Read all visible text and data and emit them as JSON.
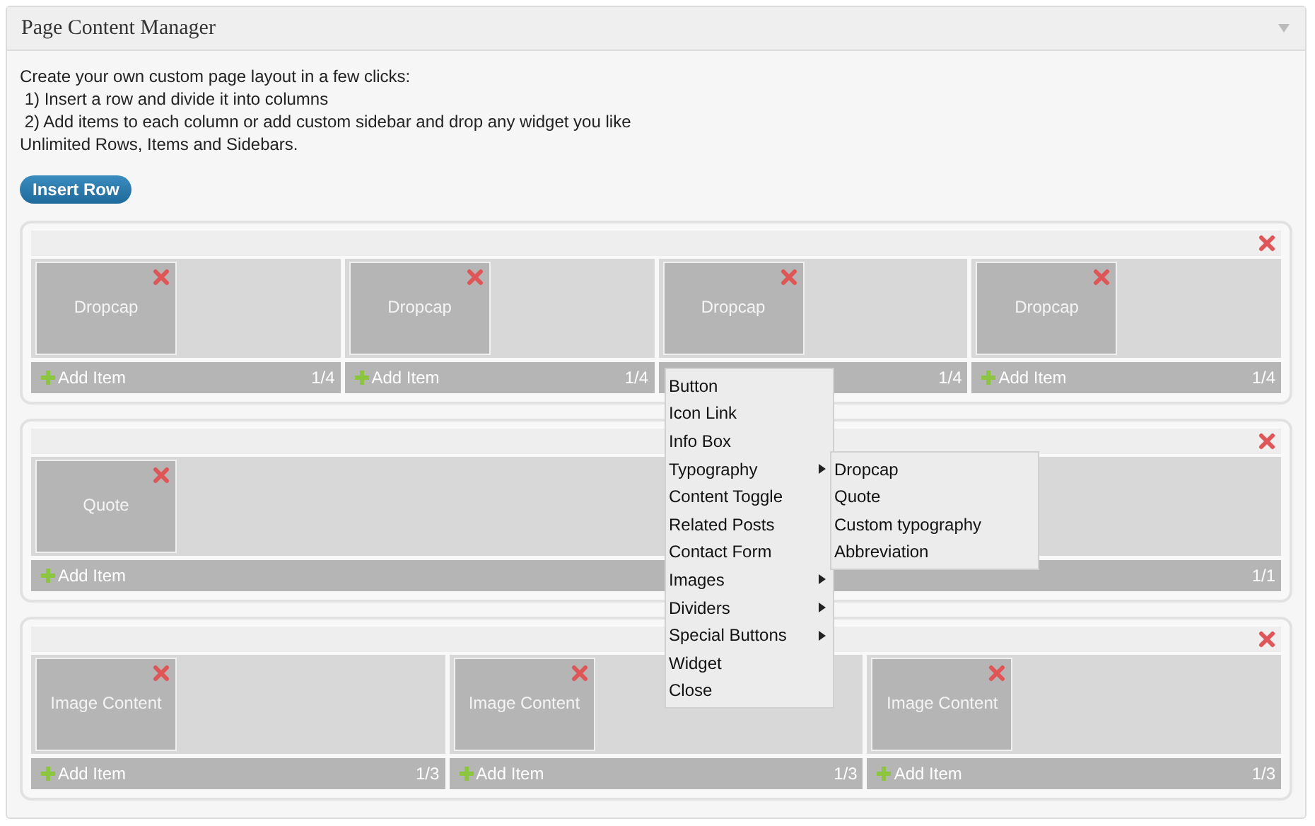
{
  "panel": {
    "title": "Page Content Manager"
  },
  "description": [
    "Create your own custom page layout in a few clicks:",
    " 1) Insert a row and divide it into columns",
    " 2) Add items to each column or add custom sidebar and drop any widget you like",
    "Unlimited Rows, Items and Sidebars."
  ],
  "insert_button": "Insert Row",
  "rows": [
    {
      "columns": [
        {
          "items": [
            "Dropcap"
          ],
          "add_item": "Add Item",
          "size": "1/4"
        },
        {
          "items": [
            "Dropcap"
          ],
          "add_item": "Add Item",
          "size": "1/4"
        },
        {
          "items": [
            "Dropcap"
          ],
          "size": "1/4"
        },
        {
          "items": [
            "Dropcap"
          ],
          "add_item": "Add Item",
          "size": "1/4"
        }
      ]
    },
    {
      "columns": [
        {
          "items": [
            "Quote"
          ],
          "add_item": "Add Item",
          "size": "1/1"
        }
      ]
    },
    {
      "columns": [
        {
          "items": [
            "Image Content"
          ],
          "add_item": "Add Item",
          "size": "1/3"
        },
        {
          "items": [
            "Image Content"
          ],
          "add_item": "Add Item",
          "size": "1/3"
        },
        {
          "items": [
            "Image Content"
          ],
          "add_item": "Add Item",
          "size": "1/3"
        }
      ]
    }
  ],
  "menu": {
    "items": [
      {
        "label": "Button",
        "has_submenu": false
      },
      {
        "label": "Icon Link",
        "has_submenu": false
      },
      {
        "label": "Info Box",
        "has_submenu": false
      },
      {
        "label": "Typography",
        "has_submenu": true,
        "children": [
          {
            "label": "Dropcap"
          },
          {
            "label": "Quote"
          },
          {
            "label": "Custom typography"
          },
          {
            "label": "Abbreviation"
          }
        ]
      },
      {
        "label": "Content Toggle",
        "has_submenu": false
      },
      {
        "label": "Related Posts",
        "has_submenu": false
      },
      {
        "label": "Contact Form",
        "has_submenu": false
      },
      {
        "label": "Images",
        "has_submenu": true
      },
      {
        "label": "Dividers",
        "has_submenu": true
      },
      {
        "label": "Special Buttons",
        "has_submenu": true
      },
      {
        "label": "Widget",
        "has_submenu": false
      },
      {
        "label": "Close",
        "has_submenu": false
      }
    ]
  }
}
